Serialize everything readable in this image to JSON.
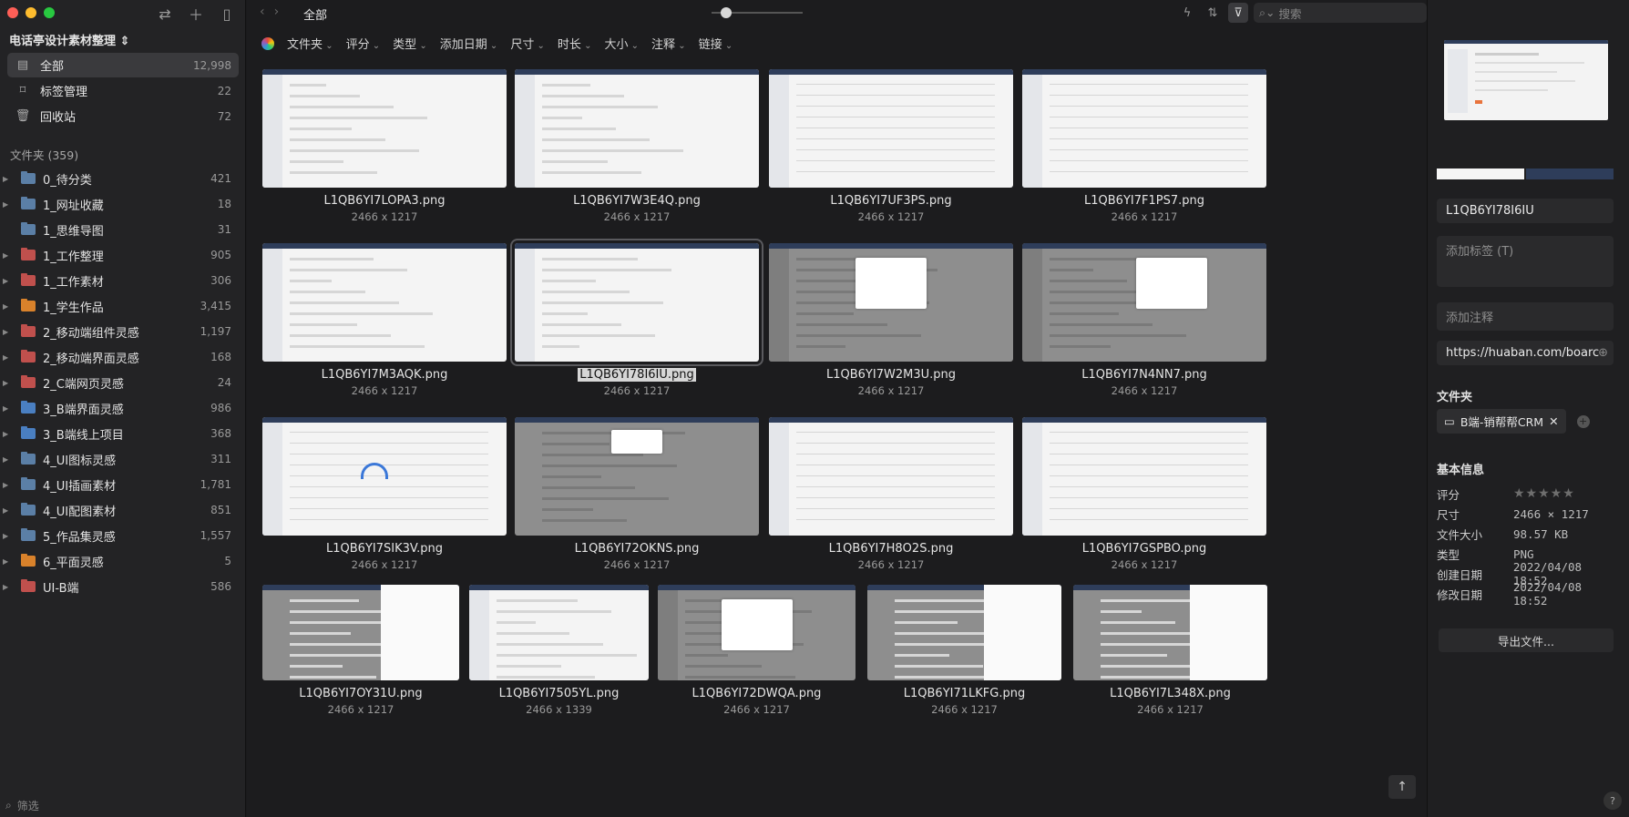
{
  "sidebar": {
    "library_name": "电话亭设计素材整理",
    "items": [
      {
        "label": "全部",
        "count": "12,998"
      },
      {
        "label": "标签管理",
        "count": "22"
      },
      {
        "label": "回收站",
        "count": "72"
      }
    ],
    "folders_heading": "文件夹 (359)",
    "folders": [
      {
        "name": "0_待分类",
        "count": "421",
        "color": "#5b7fa6"
      },
      {
        "name": "1_网址收藏",
        "count": "18",
        "color": "#5b7fa6"
      },
      {
        "name": "1_思维导图",
        "count": "31",
        "color": "#5b7fa6"
      },
      {
        "name": "1_工作整理",
        "count": "905",
        "color": "#c0504d"
      },
      {
        "name": "1_工作素材",
        "count": "306",
        "color": "#c0504d"
      },
      {
        "name": "1_学生作品",
        "count": "3,415",
        "color": "#d9822b"
      },
      {
        "name": "2_移动端组件灵感",
        "count": "1,197",
        "color": "#c0504d"
      },
      {
        "name": "2_移动端界面灵感",
        "count": "168",
        "color": "#c0504d"
      },
      {
        "name": "2_C端网页灵感",
        "count": "24",
        "color": "#c0504d"
      },
      {
        "name": "3_B端界面灵感",
        "count": "986",
        "color": "#4a7fc1"
      },
      {
        "name": "3_B端线上项目",
        "count": "368",
        "color": "#4a7fc1"
      },
      {
        "name": "4_UI图标灵感",
        "count": "311",
        "color": "#5b7fa6"
      },
      {
        "name": "4_UI插画素材",
        "count": "1,781",
        "color": "#5b7fa6"
      },
      {
        "name": "4_UI配图素材",
        "count": "851",
        "color": "#5b7fa6"
      },
      {
        "name": "5_作品集灵感",
        "count": "1,557",
        "color": "#5b7fa6"
      },
      {
        "name": "6_平面灵感",
        "count": "5",
        "color": "#d9822b"
      },
      {
        "name": "UI-B端",
        "count": "586",
        "color": "#c0504d"
      }
    ],
    "filter_placeholder": "筛选"
  },
  "toolbar": {
    "breadcrumb": "全部",
    "search_placeholder": "搜索",
    "filters": [
      "文件夹",
      "评分",
      "类型",
      "添加日期",
      "尺寸",
      "时长",
      "大小",
      "注释",
      "链接"
    ]
  },
  "grid": [
    {
      "name": "L1QB6YI7LOPA3.png",
      "dims": "2466 x 1217"
    },
    {
      "name": "L1QB6YI7W3E4Q.png",
      "dims": "2466 x 1217"
    },
    {
      "name": "L1QB6YI7UF3PS.png",
      "dims": "2466 x 1217"
    },
    {
      "name": "L1QB6YI7F1PS7.png",
      "dims": "2466 x 1217"
    },
    {
      "name": "L1QB6YI7M3AQK.png",
      "dims": "2466 x 1217"
    },
    {
      "name": "L1QB6YI78I6IU.png",
      "dims": "2466 x 1217"
    },
    {
      "name": "L1QB6YI7W2M3U.png",
      "dims": "2466 x 1217"
    },
    {
      "name": "L1QB6YI7N4NN7.png",
      "dims": "2466 x 1217"
    },
    {
      "name": "L1QB6YI7SIK3V.png",
      "dims": "2466 x 1217"
    },
    {
      "name": "L1QB6YI72OKNS.png",
      "dims": "2466 x 1217"
    },
    {
      "name": "L1QB6YI7H8O2S.png",
      "dims": "2466 x 1217"
    },
    {
      "name": "L1QB6YI7GSPBO.png",
      "dims": "2466 x 1217"
    },
    {
      "name": "L1QB6YI7OY31U.png",
      "dims": "2466 x 1217"
    },
    {
      "name": "L1QB6YI7505YL.png",
      "dims": "2466 x 1339"
    },
    {
      "name": "L1QB6YI72DWQA.png",
      "dims": "2466 x 1217"
    },
    {
      "name": "L1QB6YI71LKFG.png",
      "dims": "2466 x 1217"
    },
    {
      "name": "L1QB6YI7L348X.png",
      "dims": "2466 x 1217"
    }
  ],
  "inspector": {
    "filename": "L1QB6YI78I6IU",
    "tags_placeholder": "添加标签 (T)",
    "note_placeholder": "添加注释",
    "url": "https://huaban.com/boarc",
    "folder_heading": "文件夹",
    "folder_tag": "B端-销帮帮CRM",
    "basic_heading": "基本信息",
    "rating_label": "评分",
    "rating_value": 0,
    "rating_stars": "★★★★★",
    "size_label": "尺寸",
    "size_value": "2466 × 1217",
    "filesize_label": "文件大小",
    "filesize_value": "98.57 KB",
    "type_label": "类型",
    "type_value": "PNG",
    "created_label": "创建日期",
    "created_value": "2022/04/08 18:52",
    "modified_label": "修改日期",
    "modified_value": "2022/04/08 18:52",
    "export_label": "导出文件...",
    "palette": [
      "#f5f5f5",
      "#2e3d5a"
    ]
  }
}
